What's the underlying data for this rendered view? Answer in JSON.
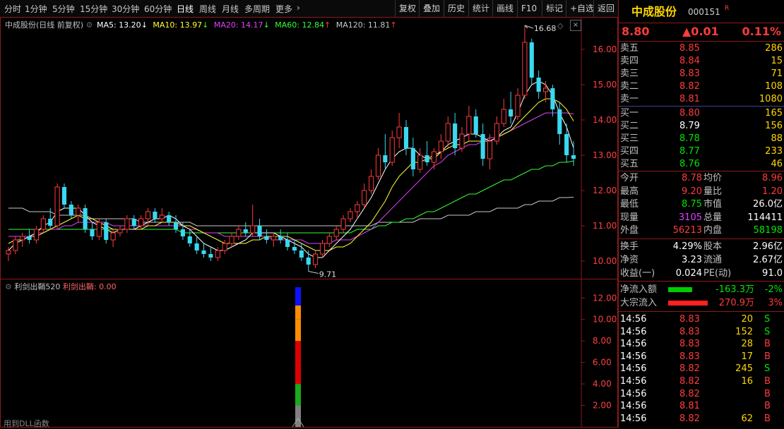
{
  "toolbar": {
    "periods": [
      "分时",
      "1分钟",
      "5分钟",
      "15分钟",
      "30分钟",
      "60分钟",
      "日线",
      "周线",
      "月线",
      "多周期",
      "更多"
    ],
    "active_period": "日线",
    "right_buttons": [
      "复权",
      "叠加",
      "历史",
      "统计",
      "画线",
      "F10",
      "标记",
      "+自选",
      "返回"
    ]
  },
  "main_legend": {
    "title": "中成股份(日线 前复权)",
    "ma5": "MA5: 13.20",
    "ma10": "MA10: 13.97",
    "ma20": "MA20: 14.17",
    "ma60": "MA60: 12.84",
    "ma120": "MA120: 11.81",
    "arrows": {
      "ma5": "↓",
      "ma10": "↓",
      "ma20": "↓",
      "ma60": "↑",
      "ma120": "↑"
    }
  },
  "main_annotations": {
    "high": "16.68",
    "low": "9.71"
  },
  "indicator_legend": {
    "name": "利剑出鞘520",
    "series": "利剑出鞘: 0.00"
  },
  "indicator_footer": "用到DLL函数",
  "colors": {
    "up": "#ff3b3b",
    "down": "#39d9f0",
    "ma5": "#ffffff",
    "ma10": "#ffff33",
    "ma20": "#e040fb",
    "ma60": "#33ff33",
    "ma120": "#c8c8c8",
    "frame": "#8b1a1a"
  },
  "chart_data": [
    {
      "type": "candlestick",
      "y_ticks": [
        "16.00",
        "15.00",
        "14.00",
        "13.00",
        "12.00",
        "11.00",
        "10.00"
      ],
      "ylim": [
        9.5,
        16.9
      ],
      "candles": [
        [
          10.2,
          10.4,
          10.0,
          10.3
        ],
        [
          10.3,
          10.7,
          10.2,
          10.6
        ],
        [
          10.6,
          10.8,
          10.4,
          10.7
        ],
        [
          10.7,
          10.9,
          10.5,
          10.6
        ],
        [
          10.6,
          11.0,
          10.5,
          10.9
        ],
        [
          10.9,
          11.3,
          10.8,
          11.2
        ],
        [
          11.2,
          11.5,
          10.9,
          11.0
        ],
        [
          11.0,
          12.2,
          10.9,
          12.1
        ],
        [
          12.1,
          12.2,
          11.5,
          11.6
        ],
        [
          11.6,
          11.7,
          11.2,
          11.3
        ],
        [
          11.3,
          11.6,
          11.1,
          11.5
        ],
        [
          11.5,
          11.6,
          10.8,
          10.9
        ],
        [
          10.9,
          11.1,
          10.6,
          10.7
        ],
        [
          10.7,
          11.2,
          10.6,
          11.1
        ],
        [
          11.1,
          11.2,
          10.5,
          10.6
        ],
        [
          10.6,
          10.9,
          10.4,
          10.8
        ],
        [
          10.8,
          11.0,
          10.7,
          10.9
        ],
        [
          10.9,
          11.3,
          10.8,
          11.2
        ],
        [
          11.2,
          11.3,
          10.9,
          11.0
        ],
        [
          11.0,
          11.3,
          10.9,
          11.2
        ],
        [
          11.2,
          11.5,
          11.0,
          11.4
        ],
        [
          11.4,
          11.5,
          11.1,
          11.2
        ],
        [
          11.2,
          11.5,
          11.1,
          11.3
        ],
        [
          11.3,
          11.4,
          11.0,
          11.1
        ],
        [
          11.1,
          11.3,
          10.8,
          10.9
        ],
        [
          10.9,
          11.1,
          10.6,
          10.7
        ],
        [
          10.7,
          10.9,
          10.4,
          10.5
        ],
        [
          10.5,
          10.7,
          10.2,
          10.3
        ],
        [
          10.3,
          10.5,
          10.1,
          10.2
        ],
        [
          10.2,
          10.4,
          10.0,
          10.1
        ],
        [
          10.1,
          10.4,
          10.0,
          10.3
        ],
        [
          10.3,
          10.6,
          10.2,
          10.5
        ],
        [
          10.5,
          10.8,
          10.4,
          10.7
        ],
        [
          10.7,
          11.0,
          10.6,
          10.9
        ],
        [
          10.9,
          11.1,
          10.7,
          10.8
        ],
        [
          10.8,
          11.6,
          10.7,
          11.0
        ],
        [
          11.0,
          11.2,
          10.6,
          10.7
        ],
        [
          10.7,
          10.9,
          10.5,
          10.6
        ],
        [
          10.6,
          10.8,
          10.4,
          10.7
        ],
        [
          10.7,
          10.9,
          10.5,
          10.6
        ],
        [
          10.6,
          10.8,
          10.3,
          10.4
        ],
        [
          10.4,
          10.6,
          10.2,
          10.3
        ],
        [
          10.3,
          10.5,
          10.0,
          10.1
        ],
        [
          10.1,
          10.3,
          9.71,
          9.9
        ],
        [
          9.9,
          10.3,
          9.8,
          10.2
        ],
        [
          10.2,
          10.6,
          10.1,
          10.5
        ],
        [
          10.5,
          10.8,
          10.4,
          10.7
        ],
        [
          10.7,
          11.0,
          10.6,
          10.9
        ],
        [
          10.9,
          11.3,
          10.8,
          11.2
        ],
        [
          11.2,
          11.5,
          11.1,
          11.4
        ],
        [
          11.4,
          11.7,
          11.2,
          11.6
        ],
        [
          11.6,
          12.2,
          11.5,
          12.0
        ],
        [
          12.0,
          12.6,
          11.9,
          12.4
        ],
        [
          12.4,
          13.2,
          12.3,
          13.0
        ],
        [
          13.0,
          13.6,
          12.6,
          12.8
        ],
        [
          12.8,
          13.7,
          12.7,
          13.5
        ],
        [
          13.5,
          14.2,
          13.2,
          13.8
        ],
        [
          13.8,
          14.0,
          13.0,
          13.2
        ],
        [
          13.2,
          13.5,
          12.4,
          12.6
        ],
        [
          12.6,
          13.2,
          12.5,
          13.0
        ],
        [
          13.0,
          13.4,
          12.7,
          12.8
        ],
        [
          12.8,
          13.2,
          12.6,
          13.1
        ],
        [
          13.1,
          13.6,
          12.9,
          13.4
        ],
        [
          13.4,
          14.1,
          13.2,
          13.9
        ],
        [
          13.9,
          14.2,
          13.0,
          13.2
        ],
        [
          13.2,
          13.8,
          13.1,
          13.6
        ],
        [
          13.6,
          14.4,
          13.4,
          14.1
        ],
        [
          14.1,
          14.3,
          13.5,
          13.6
        ],
        [
          13.6,
          13.9,
          12.7,
          12.9
        ],
        [
          12.9,
          13.6,
          12.6,
          13.4
        ],
        [
          13.4,
          14.1,
          13.3,
          13.9
        ],
        [
          13.9,
          14.6,
          13.8,
          14.3
        ],
        [
          14.3,
          14.8,
          13.9,
          14.1
        ],
        [
          14.1,
          14.9,
          14.0,
          14.7
        ],
        [
          14.7,
          16.68,
          14.6,
          16.2
        ],
        [
          16.2,
          16.3,
          15.0,
          15.2
        ],
        [
          15.2,
          15.4,
          14.6,
          14.8
        ],
        [
          14.8,
          15.1,
          14.5,
          14.9
        ],
        [
          14.9,
          15.0,
          14.1,
          14.3
        ],
        [
          14.3,
          14.5,
          13.3,
          13.6
        ],
        [
          13.6,
          13.9,
          12.8,
          13.0
        ],
        [
          13.0,
          13.4,
          12.7,
          12.9
        ]
      ],
      "mas": {
        "ma5": [
          10.3,
          10.5,
          10.6,
          10.7,
          10.8,
          11.0,
          11.1,
          11.4,
          11.5,
          11.5,
          11.5,
          11.3,
          11.1,
          11.0,
          10.9,
          10.8,
          10.9,
          10.9,
          10.9,
          11.0,
          11.1,
          11.2,
          11.2,
          11.3,
          11.2,
          11.0,
          10.9,
          10.7,
          10.5,
          10.4,
          10.3,
          10.3,
          10.4,
          10.5,
          10.6,
          10.8,
          10.8,
          10.8,
          10.8,
          10.7,
          10.6,
          10.5,
          10.4,
          10.2,
          10.1,
          10.1,
          10.3,
          10.5,
          10.7,
          10.9,
          11.2,
          11.5,
          11.8,
          12.2,
          12.6,
          12.9,
          13.1,
          13.2,
          13.2,
          13.0,
          12.9,
          12.9,
          13.1,
          13.3,
          13.4,
          13.5,
          13.6,
          13.6,
          13.5,
          13.4,
          13.5,
          13.7,
          13.8,
          14.2,
          14.7,
          15.0,
          15.1,
          15.0,
          14.7,
          14.2,
          13.8,
          13.2
        ],
        "ma10": [
          10.5,
          10.6,
          10.6,
          10.7,
          10.7,
          10.8,
          10.9,
          11.0,
          11.1,
          11.2,
          11.3,
          11.2,
          11.2,
          11.1,
          11.0,
          10.9,
          10.9,
          10.9,
          10.9,
          10.9,
          11.0,
          11.0,
          11.1,
          11.1,
          11.1,
          11.0,
          11.0,
          10.9,
          10.8,
          10.7,
          10.6,
          10.5,
          10.5,
          10.5,
          10.5,
          10.6,
          10.6,
          10.7,
          10.7,
          10.7,
          10.7,
          10.6,
          10.5,
          10.4,
          10.3,
          10.3,
          10.3,
          10.4,
          10.4,
          10.5,
          10.7,
          10.9,
          11.1,
          11.4,
          11.7,
          12.1,
          12.4,
          12.6,
          12.8,
          12.8,
          12.9,
          13.0,
          13.1,
          13.2,
          13.3,
          13.3,
          13.4,
          13.4,
          13.4,
          13.4,
          13.5,
          13.6,
          13.7,
          13.9,
          14.1,
          14.3,
          14.5,
          14.6,
          14.6,
          14.5,
          14.3,
          13.97
        ],
        "ma20": [
          10.7,
          10.7,
          10.7,
          10.7,
          10.8,
          10.8,
          10.9,
          10.9,
          11.0,
          11.0,
          11.1,
          11.1,
          11.1,
          11.1,
          11.1,
          11.0,
          11.0,
          11.0,
          11.0,
          11.0,
          11.0,
          11.0,
          11.0,
          11.0,
          11.0,
          11.0,
          10.9,
          10.9,
          10.8,
          10.8,
          10.8,
          10.7,
          10.7,
          10.7,
          10.7,
          10.7,
          10.7,
          10.7,
          10.6,
          10.6,
          10.6,
          10.6,
          10.6,
          10.5,
          10.5,
          10.5,
          10.5,
          10.6,
          10.6,
          10.6,
          10.7,
          10.8,
          10.9,
          11.1,
          11.3,
          11.5,
          11.7,
          11.9,
          12.1,
          12.3,
          12.5,
          12.7,
          12.8,
          13.0,
          13.1,
          13.2,
          13.3,
          13.3,
          13.4,
          13.5,
          13.5,
          13.6,
          13.7,
          13.8,
          13.9,
          14.0,
          14.1,
          14.2,
          14.2,
          14.2,
          14.2,
          14.17
        ],
        "ma60": [
          10.9,
          10.9,
          10.9,
          10.9,
          10.9,
          10.9,
          10.9,
          10.9,
          10.9,
          10.9,
          10.9,
          10.9,
          10.9,
          10.9,
          10.9,
          10.9,
          10.9,
          10.9,
          10.9,
          10.9,
          10.9,
          10.9,
          10.9,
          10.9,
          10.9,
          10.8,
          10.8,
          10.8,
          10.8,
          10.8,
          10.8,
          10.8,
          10.8,
          10.8,
          10.8,
          10.8,
          10.8,
          10.8,
          10.8,
          10.8,
          10.8,
          10.8,
          10.8,
          10.8,
          10.8,
          10.8,
          10.8,
          10.8,
          10.8,
          10.8,
          10.9,
          10.9,
          10.9,
          11.0,
          11.0,
          11.1,
          11.1,
          11.2,
          11.2,
          11.3,
          11.4,
          11.4,
          11.5,
          11.6,
          11.7,
          11.8,
          11.9,
          11.9,
          12.0,
          12.1,
          12.2,
          12.3,
          12.3,
          12.4,
          12.5,
          12.6,
          12.6,
          12.7,
          12.7,
          12.8,
          12.8,
          12.84
        ],
        "ma120": [
          11.5,
          11.5,
          11.5,
          11.4,
          11.4,
          11.4,
          11.4,
          11.3,
          11.3,
          11.3,
          11.3,
          11.3,
          11.2,
          11.2,
          11.2,
          11.2,
          11.2,
          11.2,
          11.2,
          11.1,
          11.1,
          11.1,
          11.1,
          11.1,
          11.1,
          11.1,
          11.1,
          11.0,
          11.0,
          11.0,
          11.0,
          11.0,
          11.0,
          11.0,
          11.0,
          11.0,
          11.0,
          11.0,
          11.0,
          11.0,
          11.0,
          11.0,
          11.0,
          11.0,
          11.0,
          11.0,
          11.0,
          11.0,
          11.0,
          11.0,
          11.0,
          11.0,
          11.0,
          11.1,
          11.1,
          11.1,
          11.1,
          11.1,
          11.1,
          11.2,
          11.2,
          11.2,
          11.2,
          11.3,
          11.3,
          11.3,
          11.3,
          11.4,
          11.4,
          11.4,
          11.5,
          11.5,
          11.5,
          11.5,
          11.6,
          11.6,
          11.7,
          11.7,
          11.7,
          11.8,
          11.8,
          11.81
        ]
      }
    },
    {
      "type": "bar",
      "y_ticks": [
        "12.00",
        "10.00",
        "8.00",
        "6.00",
        "4.00",
        "2.00"
      ],
      "ylim": [
        0,
        13.2
      ],
      "segments": [
        {
          "from": 0,
          "to": 2,
          "color": "#808080"
        },
        {
          "from": 2,
          "to": 4,
          "color": "#1aaa1a"
        },
        {
          "from": 4,
          "to": 6,
          "color": "#dd0000"
        },
        {
          "from": 6,
          "to": 8,
          "color": "#dd0000"
        },
        {
          "from": 8,
          "to": 10,
          "color": "#ff8c00"
        },
        {
          "from": 10,
          "to": 11.3,
          "color": "#ff8c00"
        },
        {
          "from": 11.3,
          "to": 13.0,
          "color": "#1010ff"
        }
      ]
    }
  ],
  "quote": {
    "name": "中成股份",
    "code": "000151",
    "flag": "R",
    "price": "8.80",
    "change": "▲0.01",
    "change_pct": "0.11%",
    "asks": [
      {
        "label": "卖五",
        "price": "8.85",
        "vol": "286"
      },
      {
        "label": "卖四",
        "price": "8.84",
        "vol": "15"
      },
      {
        "label": "卖三",
        "price": "8.83",
        "vol": "71"
      },
      {
        "label": "卖二",
        "price": "8.82",
        "vol": "108"
      },
      {
        "label": "卖一",
        "price": "8.81",
        "vol": "1080"
      }
    ],
    "bids": [
      {
        "label": "买一",
        "price": "8.80",
        "vol": "165"
      },
      {
        "label": "买二",
        "price": "8.79",
        "vol": "156"
      },
      {
        "label": "买三",
        "price": "8.78",
        "vol": "88"
      },
      {
        "label": "买四",
        "price": "8.77",
        "vol": "233"
      },
      {
        "label": "买五",
        "price": "8.76",
        "vol": "46"
      }
    ],
    "stats": [
      {
        "l1": "今开",
        "v1": "8.78",
        "l2": "均价",
        "v2": "8.96"
      },
      {
        "l1": "最高",
        "v1": "9.20",
        "l2": "量比",
        "v2": "1.20"
      },
      {
        "l1": "最低",
        "v1": "8.75",
        "l2": "市值",
        "v2": "26.0亿"
      },
      {
        "l1": "现量",
        "v1": "3105",
        "l2": "总量",
        "v2": "114411"
      },
      {
        "l1": "外盘",
        "v1": "56213",
        "l2": "内盘",
        "v2": "58198"
      }
    ],
    "stats2": [
      {
        "l1": "换手",
        "v1": "4.29%",
        "l2": "股本",
        "v2": "2.96亿"
      },
      {
        "l1": "净资",
        "v1": "3.23",
        "l2": "流通",
        "v2": "2.67亿"
      },
      {
        "l1": "收益(一)",
        "v1": "0.024",
        "l2": "PE(动)",
        "v2": "91.0"
      }
    ],
    "flows": [
      {
        "label": "净流入额",
        "value": "-163.3万",
        "pct": "-2%",
        "bar_color": "#00cc00"
      },
      {
        "label": "大宗流入",
        "value": "270.9万",
        "pct": "3%",
        "bar_color": "#ff2020"
      }
    ],
    "ticks": [
      {
        "time": "14:56",
        "price": "8.83",
        "vol": "20",
        "side": "S"
      },
      {
        "time": "14:56",
        "price": "8.83",
        "vol": "152",
        "side": "S"
      },
      {
        "time": "14:56",
        "price": "8.83",
        "vol": "28",
        "side": "B"
      },
      {
        "time": "14:56",
        "price": "8.83",
        "vol": "17",
        "side": "B"
      },
      {
        "time": "14:56",
        "price": "8.82",
        "vol": "245",
        "side": "S"
      },
      {
        "time": "14:56",
        "price": "8.82",
        "vol": "16",
        "side": "B"
      },
      {
        "time": "14:56",
        "price": "8.82",
        "vol": "",
        "side": "B"
      },
      {
        "time": "14:56",
        "price": "8.81",
        "vol": "",
        "side": "B"
      },
      {
        "time": "14:56",
        "price": "8.82",
        "vol": "62",
        "side": "B"
      }
    ]
  }
}
